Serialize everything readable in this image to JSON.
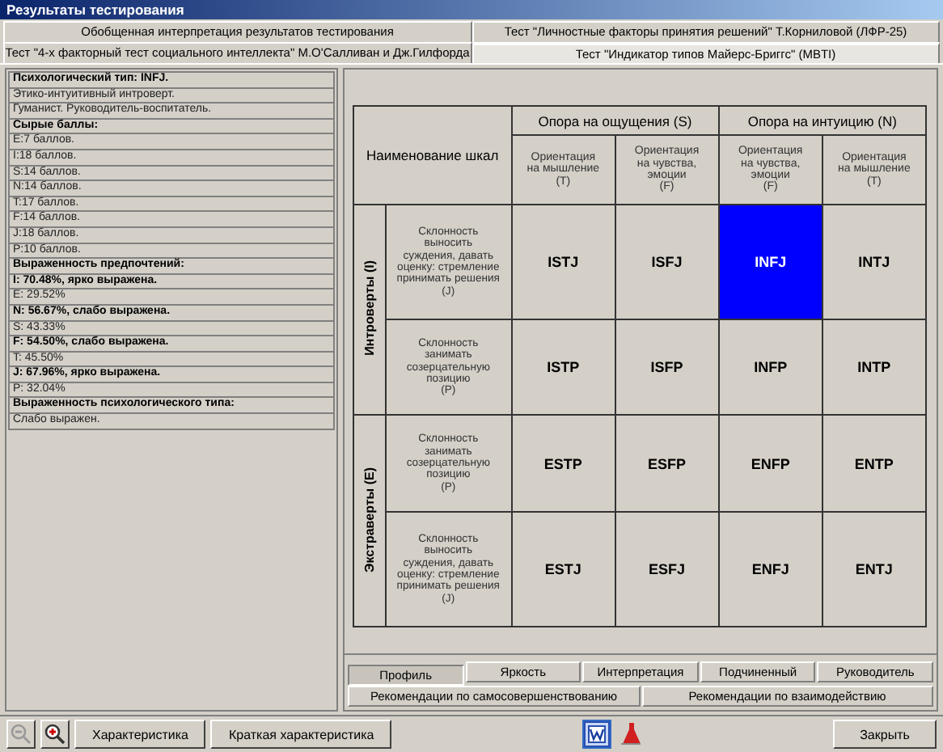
{
  "window": {
    "title": "Результаты тестирования"
  },
  "tab_rows": [
    {
      "tabs": [
        {
          "label": "Обобщенная интерпретация результатов тестирования",
          "selected": false
        },
        {
          "label": "Тест \"Личностные факторы принятия решений\" Т.Корниловой (ЛФР-25)",
          "selected": false
        }
      ]
    },
    {
      "tabs": [
        {
          "label": "Тест \"4-х факторный тест социального интеллекта\" М.О'Салливан и Дж.Гилфорда",
          "selected": false
        },
        {
          "label": "Тест \"Индикатор типов Майерс-Бриггс\" (MBTI)",
          "selected": true
        }
      ]
    }
  ],
  "left_panel": {
    "items": [
      {
        "text": "Психологический тип: INFJ.",
        "kind": "header"
      },
      {
        "text": "Этико-интуитивный интроверт.",
        "kind": "value"
      },
      {
        "text": "Гуманист. Руководитель-воспитатель.",
        "kind": "value"
      },
      {
        "text": "Сырые баллы:",
        "kind": "header"
      },
      {
        "text": "E:7 баллов.",
        "kind": "value"
      },
      {
        "text": "I:18 баллов.",
        "kind": "value"
      },
      {
        "text": "S:14 баллов.",
        "kind": "value"
      },
      {
        "text": "N:14 баллов.",
        "kind": "value"
      },
      {
        "text": "T:17 баллов.",
        "kind": "value"
      },
      {
        "text": "F:14 баллов.",
        "kind": "value"
      },
      {
        "text": "J:18 баллов.",
        "kind": "value"
      },
      {
        "text": "P:10 баллов.",
        "kind": "value"
      },
      {
        "text": "Выраженность предпочтений:",
        "kind": "header"
      },
      {
        "text": "I: 70.48%, ярко выражена.",
        "kind": "header"
      },
      {
        "text": "E: 29.52%",
        "kind": "value"
      },
      {
        "text": "N: 56.67%, слабо выражена.",
        "kind": "header"
      },
      {
        "text": "S: 43.33%",
        "kind": "value"
      },
      {
        "text": "F: 54.50%, слабо выражена.",
        "kind": "header"
      },
      {
        "text": "T: 45.50%",
        "kind": "value"
      },
      {
        "text": "J: 67.96%, ярко выражена.",
        "kind": "header"
      },
      {
        "text": "P: 32.04%",
        "kind": "value"
      },
      {
        "text": "Выраженность психологического типа:",
        "kind": "header"
      },
      {
        "text": "Слабо выражен.",
        "kind": "value"
      }
    ]
  },
  "grid": {
    "corner": "Наименование шкал",
    "column_groups": [
      {
        "label": "Опора на ощущения (S)",
        "columns": [
          "Ориентация\nна мышление\n(T)",
          "Ориентация\nна чувства,\nэмоции\n(F)"
        ]
      },
      {
        "label": "Опора на интуицию (N)",
        "columns": [
          "Ориентация\nна чувства,\nэмоции\n(F)",
          "Ориентация\nна мышление\n(T)"
        ]
      }
    ],
    "row_groups": [
      {
        "label": "Интроверты (I)",
        "rows": [
          {
            "scale": "Склонность\nвыносить\nсуждения, давать\nоценку: стремление\nпринимать решения\n(J)",
            "cells": [
              {
                "type": "ISTJ",
                "selected": false
              },
              {
                "type": "ISFJ",
                "selected": false
              },
              {
                "type": "INFJ",
                "selected": true
              },
              {
                "type": "INTJ",
                "selected": false
              }
            ]
          },
          {
            "scale": "Склонность\nзанимать\nсозерцательную\nпозицию\n(P)",
            "cells": [
              {
                "type": "ISTP",
                "selected": false
              },
              {
                "type": "ISFP",
                "selected": false
              },
              {
                "type": "INFP",
                "selected": false
              },
              {
                "type": "INTP",
                "selected": false
              }
            ]
          }
        ]
      },
      {
        "label": "Экстраверты (E)",
        "rows": [
          {
            "scale": "Склонность\nзанимать\nсозерцательную\nпозицию\n(P)",
            "cells": [
              {
                "type": "ESTP",
                "selected": false
              },
              {
                "type": "ESFP",
                "selected": false
              },
              {
                "type": "ENFP",
                "selected": false
              },
              {
                "type": "ENTP",
                "selected": false
              }
            ]
          },
          {
            "scale": "Склонность\nвыносить\nсуждения, давать\nоценку: стремление\nпринимать решения\n(J)",
            "cells": [
              {
                "type": "ESTJ",
                "selected": false
              },
              {
                "type": "ESFJ",
                "selected": false
              },
              {
                "type": "ENFJ",
                "selected": false
              },
              {
                "type": "ENTJ",
                "selected": false
              }
            ]
          }
        ]
      }
    ]
  },
  "bottom_tab_rows": [
    {
      "tabs": [
        {
          "label": "Профиль",
          "selected": true
        },
        {
          "label": "Яркость",
          "selected": false
        },
        {
          "label": "Интерпретация",
          "selected": false
        },
        {
          "label": "Подчиненный",
          "selected": false
        },
        {
          "label": "Руководитель",
          "selected": false
        }
      ]
    },
    {
      "tabs": [
        {
          "label": "Рекомендации по самосовершенствованию",
          "selected": false
        },
        {
          "label": "Рекомендации по взаимодействию",
          "selected": false
        }
      ]
    }
  ],
  "toolbar": {
    "zoom_out_disabled": true,
    "buttons": [
      "Характеристика",
      "Краткая характеристика"
    ],
    "close": "Закрыть"
  }
}
